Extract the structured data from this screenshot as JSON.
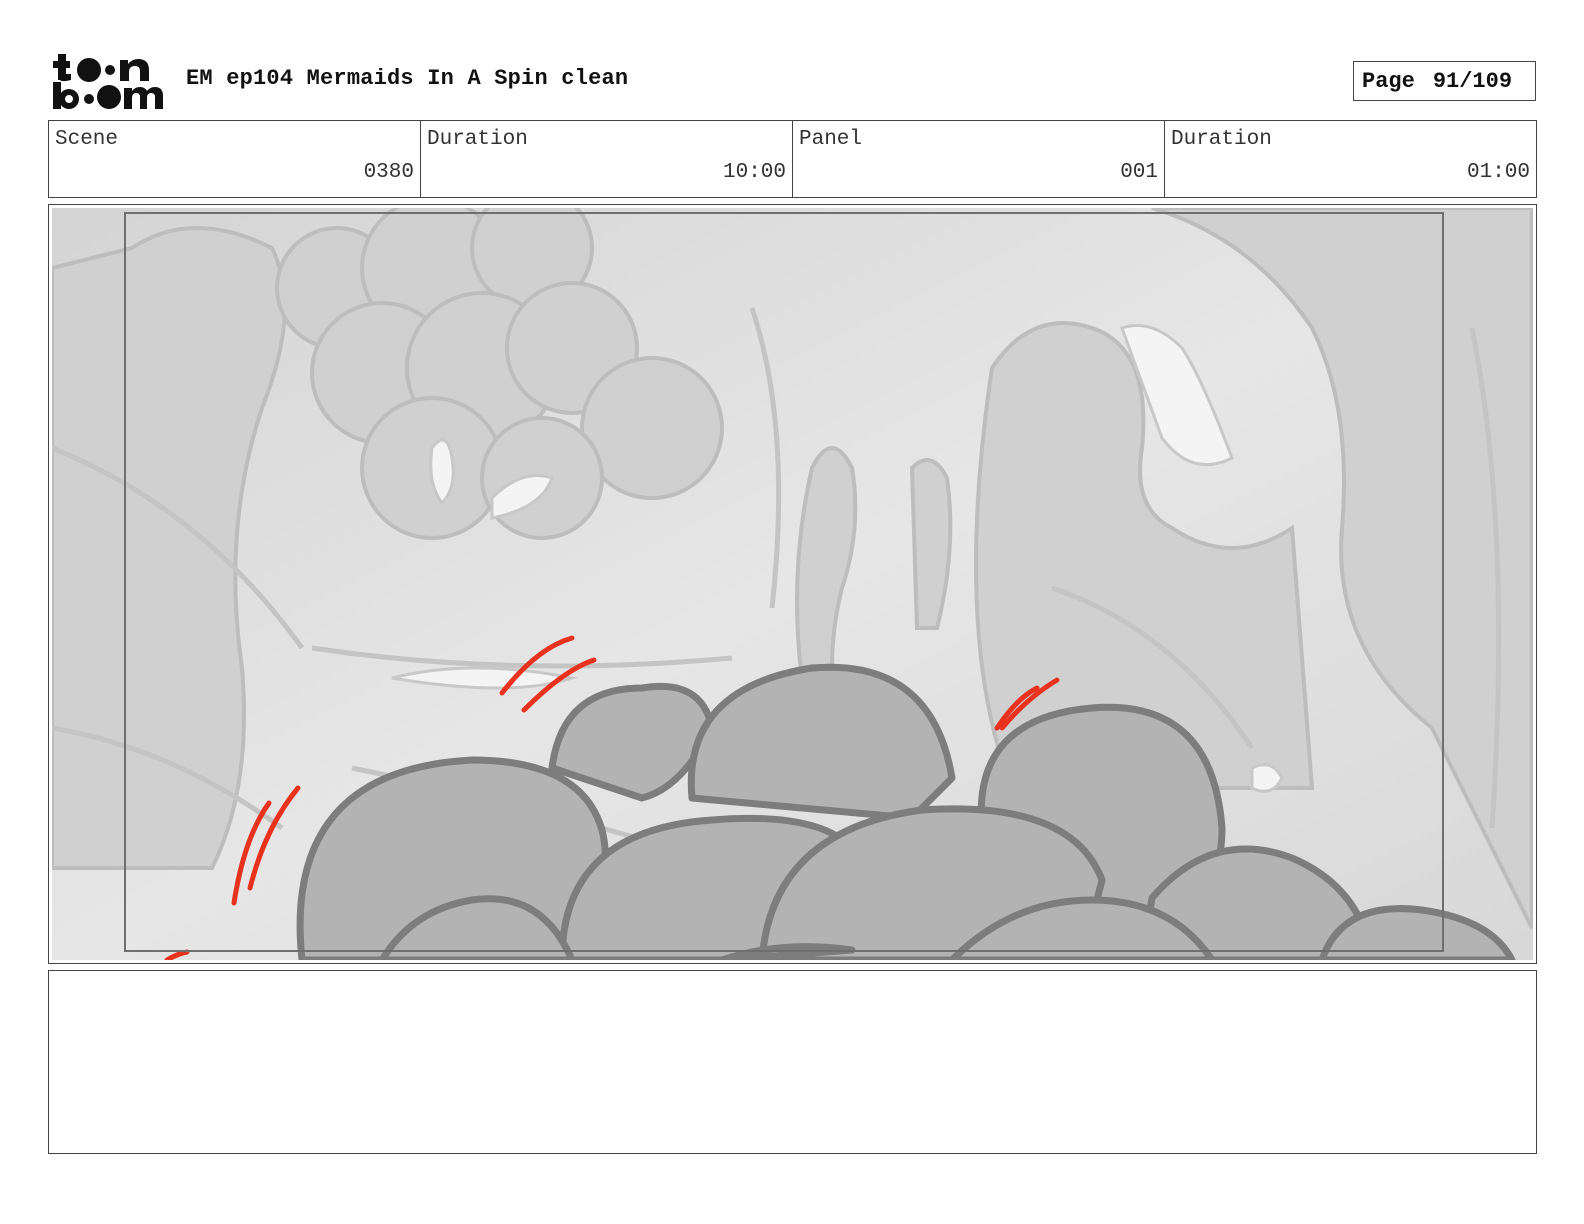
{
  "header": {
    "logo_alt": "toon boom",
    "title": "EM ep104 Mermaids In A Spin clean",
    "page_label": "Page",
    "page_value": "91/109"
  },
  "info": {
    "scene_label": "Scene",
    "scene_value": "0380",
    "scene_duration_label": "Duration",
    "scene_duration_value": "10:00",
    "panel_label": "Panel",
    "panel_value": "001",
    "panel_duration_label": "Duration",
    "panel_duration_value": "01:00"
  },
  "panel_image": {
    "description_icon": "storyboard-drawing",
    "accent_color": "#e8321e",
    "cloud_fill": "#b3b3b3",
    "cloud_stroke": "#7d7d7d",
    "background_tone": "#dedede"
  },
  "notes": {
    "text": ""
  }
}
